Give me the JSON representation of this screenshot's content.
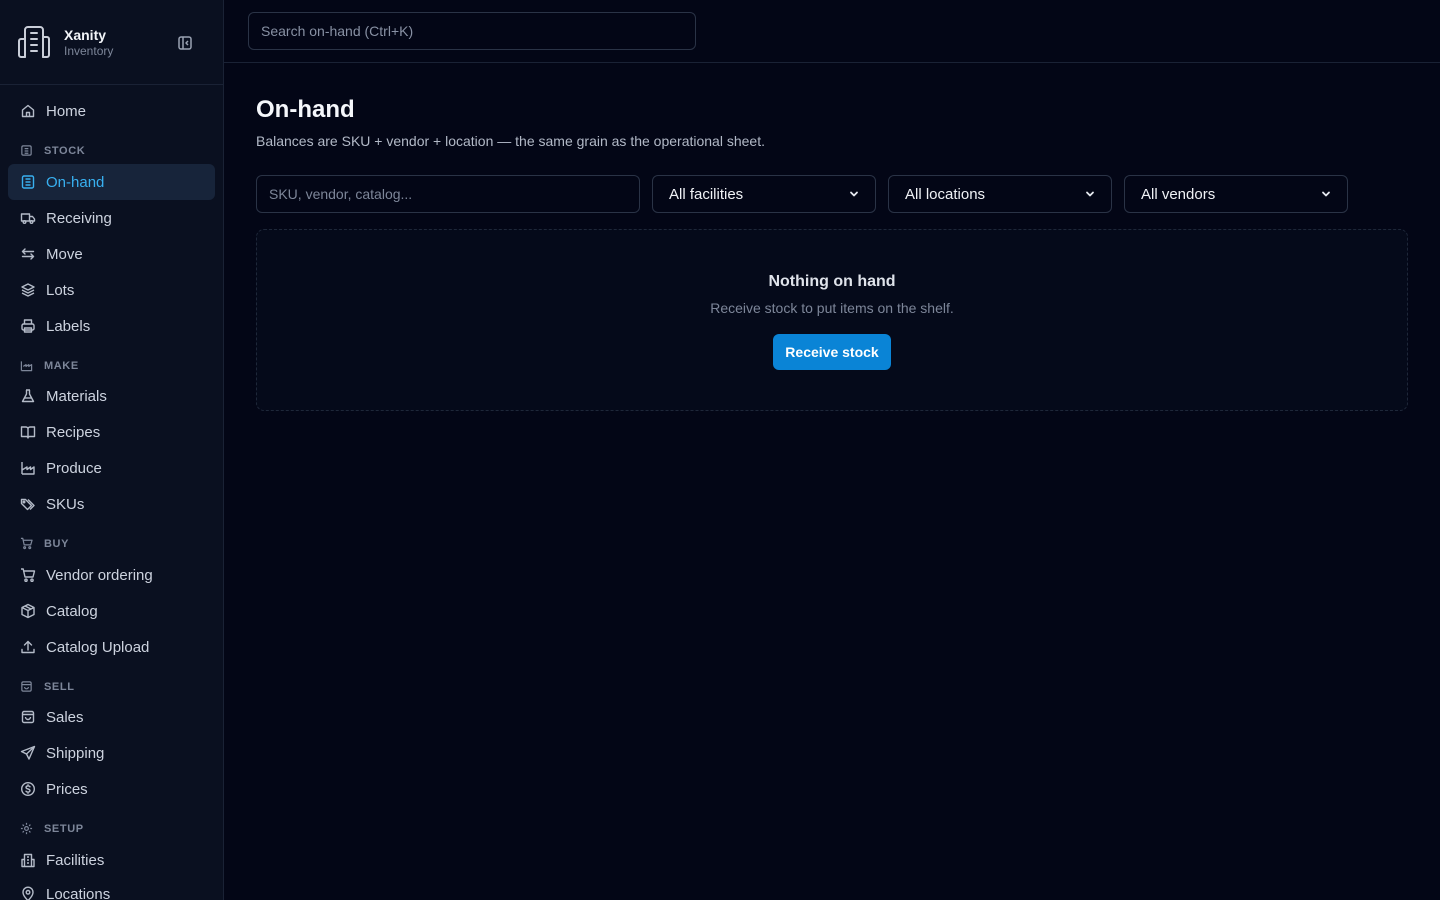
{
  "brand": {
    "name": "Xanity",
    "subtitle": "Inventory"
  },
  "search": {
    "placeholder": "Search on-hand (Ctrl+K)"
  },
  "sidebar": {
    "home": {
      "label": "Home",
      "icon": "home-icon"
    },
    "sections": [
      {
        "title": "STOCK",
        "icon": "building-icon",
        "items": [
          {
            "label": "On-hand",
            "icon": "building-icon",
            "active": true
          },
          {
            "label": "Receiving",
            "icon": "truck-icon"
          },
          {
            "label": "Move",
            "icon": "arrows-left-right-icon"
          },
          {
            "label": "Lots",
            "icon": "layers-icon"
          },
          {
            "label": "Labels",
            "icon": "printer-icon"
          }
        ]
      },
      {
        "title": "MAKE",
        "icon": "factory-icon",
        "items": [
          {
            "label": "Materials",
            "icon": "flask-icon"
          },
          {
            "label": "Recipes",
            "icon": "book-icon"
          },
          {
            "label": "Produce",
            "icon": "factory-icon"
          },
          {
            "label": "SKUs",
            "icon": "tags-icon"
          }
        ]
      },
      {
        "title": "BUY",
        "icon": "cart-icon",
        "items": [
          {
            "label": "Vendor ordering",
            "icon": "cart-icon"
          },
          {
            "label": "Catalog",
            "icon": "package-icon"
          },
          {
            "label": "Catalog Upload",
            "icon": "upload-icon"
          }
        ]
      },
      {
        "title": "SELL",
        "icon": "shopping-bag-icon",
        "items": [
          {
            "label": "Sales",
            "icon": "shopping-bag-icon"
          },
          {
            "label": "Shipping",
            "icon": "send-icon"
          },
          {
            "label": "Prices",
            "icon": "dollar-circle-icon"
          }
        ]
      },
      {
        "title": "SETUP",
        "icon": "gear-icon",
        "items": [
          {
            "label": "Facilities",
            "icon": "building-icon"
          },
          {
            "label": "Locations",
            "icon": "map-pin-icon"
          }
        ]
      }
    ]
  },
  "page": {
    "title": "On-hand",
    "subtitle": "Balances are SKU + vendor + location — the same grain as the operational sheet.",
    "filter_placeholder": "SKU, vendor, catalog...",
    "filters": {
      "facility": "All facilities",
      "location": "All locations",
      "vendor": "All vendors"
    },
    "empty": {
      "title": "Nothing on hand",
      "message": "Receive stock to put items on the shelf.",
      "button": "Receive stock"
    }
  },
  "colors": {
    "accent": "#38b0f0",
    "button": "#0a84d6",
    "background": "#030616",
    "sidebar": "#0a1020"
  }
}
